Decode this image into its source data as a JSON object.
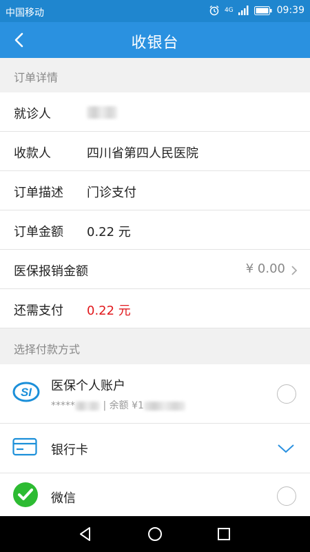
{
  "status_bar": {
    "carrier": "中国移动",
    "network": "4G",
    "time": "09:39"
  },
  "header": {
    "title": "收银台",
    "back_icon": "chevron-left-icon"
  },
  "order": {
    "section_title": "订单详情",
    "patient_label": "就诊人",
    "payee_label": "收款人",
    "payee_value": "四川省第四人民医院",
    "desc_label": "订单描述",
    "desc_value": "门诊支付",
    "amount_label": "订单金额",
    "amount_value": "0.22 元",
    "insurance_label": "医保报销金额",
    "insurance_value": "¥ 0.00",
    "due_label": "还需支付",
    "due_value": "0.22 元"
  },
  "payment": {
    "section_title": "选择付款方式",
    "methods": [
      {
        "name": "医保个人账户",
        "sub_prefix": "*****",
        "sub_balance": "| 余额 ¥1",
        "icon": "social-insurance-icon"
      },
      {
        "name": "银行卡",
        "icon": "bank-card-icon"
      },
      {
        "name": "微信",
        "icon": "wechat-pay-icon"
      }
    ]
  },
  "colors": {
    "primary": "#2a91e0",
    "due_red": "#e1181c"
  }
}
